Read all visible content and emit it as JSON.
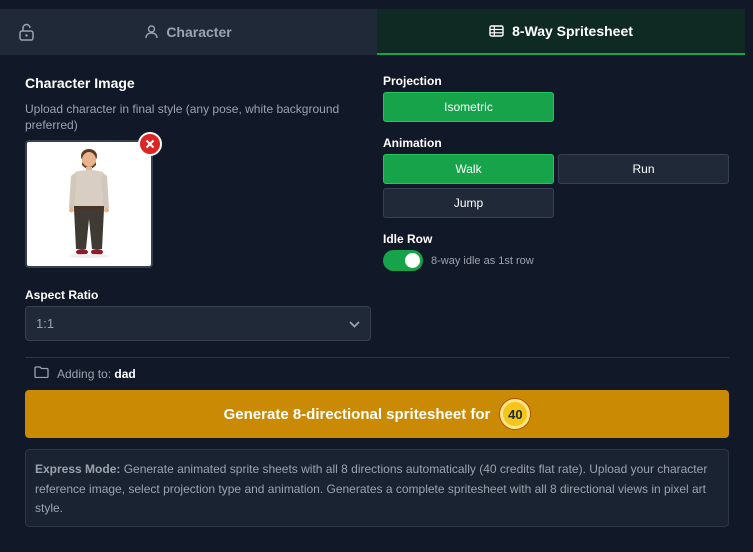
{
  "tabs": [
    {
      "label": "Character",
      "icon": "user-icon",
      "active": false
    },
    {
      "label": "8-Way Spritesheet",
      "icon": "spritesheet-icon",
      "active": true
    }
  ],
  "character_image": {
    "title": "Character Image",
    "hint": "Upload character in final style (any pose, white background preferred)"
  },
  "aspect_ratio": {
    "label": "Aspect Ratio",
    "selected": "1:1"
  },
  "projection": {
    "label": "Projection",
    "options": [
      "Isometric"
    ],
    "selected": "Isometric"
  },
  "animation": {
    "label": "Animation",
    "options": [
      "Walk",
      "Run",
      "Jump"
    ],
    "selected": "Walk"
  },
  "idle_row": {
    "label": "Idle Row",
    "toggle_text": "8-way idle as 1st row",
    "enabled": true
  },
  "adding_to": {
    "prefix": "Adding to:",
    "target": "dad"
  },
  "generate": {
    "label": "Generate 8-directional spritesheet for",
    "credits": "40"
  },
  "info": {
    "title": "Express Mode:",
    "text": "Generate animated sprite sheets with all 8 directions automatically (40 credits flat rate). Upload your character reference image, select projection type and animation. Generates a complete spritesheet with all 8 directional views in pixel art style."
  },
  "colors": {
    "background": "#111827",
    "accent_green": "#16a34a",
    "generate_gold": "#ca8a04",
    "remove_red": "#dc2626"
  }
}
